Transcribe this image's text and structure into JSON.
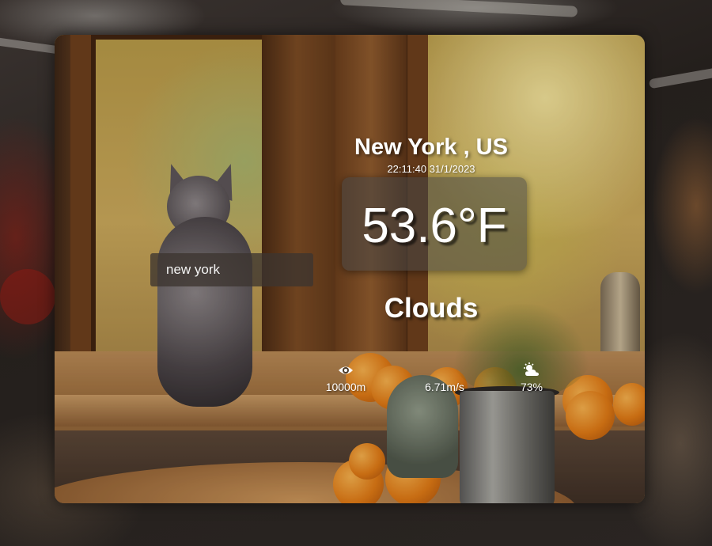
{
  "search": {
    "value": "new york"
  },
  "location": {
    "city_country": "New York , US",
    "datetime": "22:11:40 31/1/2023"
  },
  "current": {
    "temperature": "53.6°F",
    "condition": "Clouds"
  },
  "stats": [
    {
      "icon": "eye-icon",
      "value": "10000m"
    },
    {
      "icon": "wind-icon",
      "value": "6.71m/s"
    },
    {
      "icon": "cloud-sun-icon",
      "value": "73%"
    }
  ]
}
